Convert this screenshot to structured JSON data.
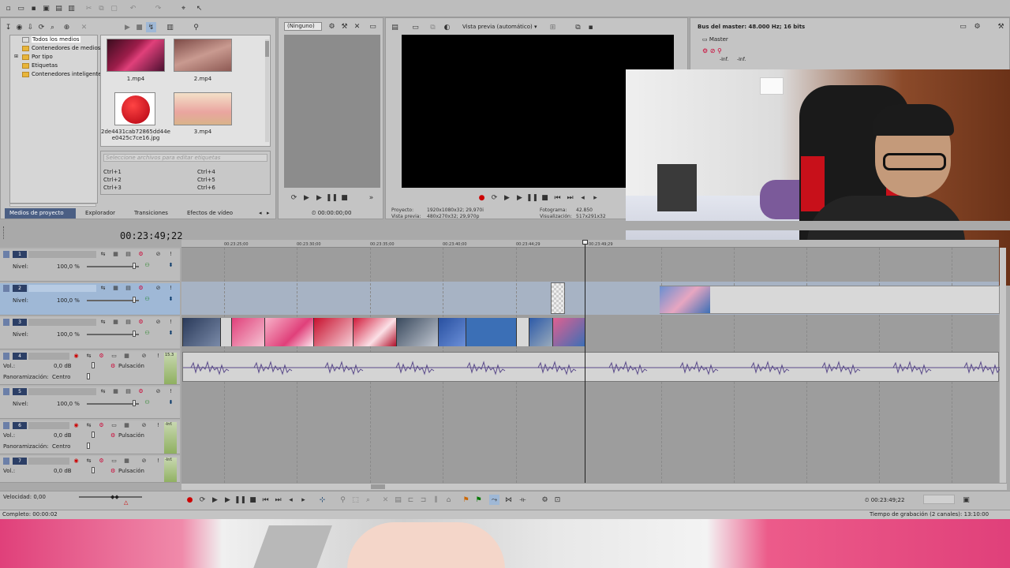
{
  "toolbar": {
    "icons": [
      "new-icon",
      "open-icon",
      "save-icon",
      "render-icon",
      "properties-icon",
      "cut-icon",
      "copy-icon",
      "paste-icon",
      "undo-icon",
      "redo-icon",
      "enable-snapping-icon",
      "cursor-icon"
    ]
  },
  "explorer": {
    "tree": [
      "Todos los medios",
      "Contenedores de medios",
      "Por tipo",
      "Etiquetas",
      "Contenedores inteligente"
    ],
    "media": [
      {
        "label": "1.mp4"
      },
      {
        "label": "2.mp4"
      },
      {
        "label": "2de4431cab72865dd44e e0425c7ce16.jpg"
      },
      {
        "label": "3.mp4"
      }
    ],
    "tag_placeholder": "Seleccione archivos para editar etiquetas",
    "shortcuts": [
      "Ctrl+1",
      "Ctrl+2",
      "Ctrl+3",
      "Ctrl+4",
      "Ctrl+5",
      "Ctrl+6"
    ],
    "tabs": [
      "Medios de proyecto",
      "Explorador",
      "Transiciones",
      "Efectos de vídeo"
    ]
  },
  "trimmer": {
    "dropdown": "(Ninguno)",
    "timecode": "00:00:00;00"
  },
  "preview": {
    "mode": "Vista previa (automático)",
    "project_label": "Proyecto:",
    "project_value": "1920x1080x32; 29,970i",
    "preview_label": "Vista previa:",
    "preview_value": "480x270x32; 29,970p",
    "frame_label": "Fotograma:",
    "frame_value": "42.850",
    "display_label": "Visualización:",
    "display_value": "517x291x32"
  },
  "master": {
    "title": "Bus del master: 48.000 Hz; 16 bits",
    "label": "Master",
    "inf1": "-Inf.",
    "inf2": "-Inf."
  },
  "timeline": {
    "timecode": "00:23:49;22",
    "ruler": [
      "00:23:25;00",
      "00:23:30;00",
      "00:23:35;00",
      "00:23:40;00",
      "00:23:44;29",
      "00:23:49;29"
    ],
    "tracks": [
      {
        "num": "1",
        "level_label": "Nivel:",
        "level": "100,0 %"
      },
      {
        "num": "2",
        "level_label": "Nivel:",
        "level": "100,0 %"
      },
      {
        "num": "3",
        "level_label": "Nivel:",
        "level": "100,0 %"
      },
      {
        "num": "4",
        "vol_label": "Vol.:",
        "vol": "0,0 dB",
        "pan_label": "Panoramización:",
        "pan": "Centro",
        "mode": "Pulsación"
      },
      {
        "num": "5",
        "level_label": "Nivel:",
        "level": "100,0 %"
      },
      {
        "num": "6",
        "vol_label": "Vol.:",
        "vol": "0,0 dB",
        "pan_label": "Panoramización:",
        "pan": "Centro",
        "mode": "Pulsación"
      },
      {
        "num": "7",
        "vol_label": "Vol.:",
        "vol": "0,0 dB",
        "mode": "Pulsación"
      }
    ],
    "meter_top": "15.3",
    "meter_inf": "-Inf."
  },
  "transport": {
    "speed": "Velocidad: 0,00",
    "timecode": "00:23:49;22"
  },
  "status": {
    "left": "Completo: 00:00:02",
    "right": "Tiempo de grabación (2 canales): 13:10:00"
  },
  "colors": {
    "track_num": "#2c3f66",
    "selected_track": "#9fb8d6",
    "waveform": "#5a4a8a",
    "clip_blue": "#3b6fb6",
    "pink": "#e0407a"
  }
}
